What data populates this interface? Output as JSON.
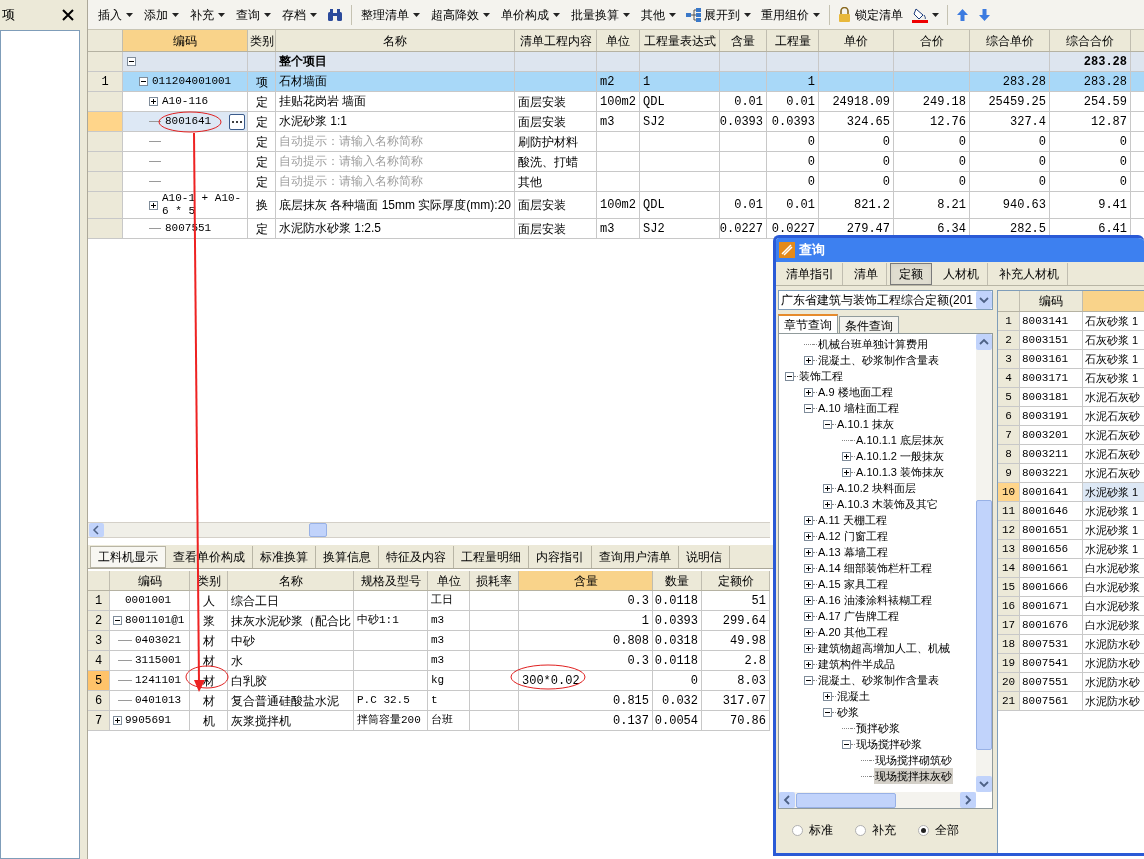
{
  "side_panel": {
    "title": "项"
  },
  "toolbar": [
    {
      "kind": "dropdown",
      "label": "插入"
    },
    {
      "kind": "dropdown",
      "label": "添加"
    },
    {
      "kind": "dropdown",
      "label": "补充"
    },
    {
      "kind": "dropdown",
      "label": "查询"
    },
    {
      "kind": "dropdown",
      "label": "存档"
    },
    {
      "kind": "find"
    },
    {
      "kind": "separator"
    },
    {
      "kind": "dropdown",
      "label": "整理清单"
    },
    {
      "kind": "dropdown",
      "label": "超高降效"
    },
    {
      "kind": "dropdown",
      "label": "单价构成"
    },
    {
      "kind": "dropdown",
      "label": "批量换算"
    },
    {
      "kind": "dropdown",
      "label": "其他"
    },
    {
      "kind": "expand",
      "label": "展开到"
    },
    {
      "kind": "dropdown",
      "label": "重用组价"
    },
    {
      "kind": "separator"
    },
    {
      "kind": "lock",
      "label": "锁定清单"
    },
    {
      "kind": "fill"
    },
    {
      "kind": "separator"
    },
    {
      "kind": "up"
    },
    {
      "kind": "down"
    }
  ],
  "bill_table": {
    "columns": [
      {
        "label": "编码",
        "selected": true
      },
      {
        "label": "类别",
        "selected": false
      },
      {
        "label": "名称",
        "selected": false
      },
      {
        "label": "清单工程内容",
        "selected": false
      },
      {
        "label": "单位",
        "selected": false
      },
      {
        "label": "工程量表达式",
        "selected": false
      },
      {
        "label": "含量",
        "selected": false
      },
      {
        "label": "工程量",
        "selected": false
      },
      {
        "label": "单价",
        "selected": false
      },
      {
        "label": "合价",
        "selected": false
      },
      {
        "label": "综合单价",
        "selected": false
      },
      {
        "label": "综合合价",
        "selected": false
      }
    ],
    "rows": [
      {
        "kind": "summary",
        "name": "整个项目",
        "comp_total": "283.28",
        "selected": false,
        "current": false,
        "expanded": true,
        "children": [
          {
            "number": "1",
            "code": "011204001001",
            "type": "项",
            "name": "石材墙面",
            "unit": "m2",
            "expr": "1",
            "quantity": "1",
            "comp_price": "283.28",
            "comp_total": "283.28",
            "selected": true,
            "current": false,
            "expanded": true,
            "children": [
              {
                "code": "A10-116",
                "type": "定",
                "name": "挂贴花岗岩 墙面",
                "content": "面层安装",
                "unit": "100m2",
                "expr": "QDL",
                "rate": "0.01",
                "quantity": "0.01",
                "price": "24918.09",
                "total": "249.18",
                "comp_price": "25459.25",
                "comp_total": "254.59",
                "selected": false,
                "current": false,
                "expanded": false
              },
              {
                "code": "8001641",
                "type": "定",
                "name": "水泥砂浆 1:1",
                "content": "面层安装",
                "unit": "m3",
                "expr": "SJ2",
                "rate": "0.0393",
                "quantity": "0.0393",
                "price": "324.65",
                "total": "12.76",
                "comp_price": "327.4",
                "comp_total": "12.87",
                "selected": false,
                "current": true
              },
              {
                "type": "定",
                "placeholder": "自动提示：请输入名称简称",
                "content": "刷防护材料",
                "quantity": "0",
                "price": "0",
                "total": "0",
                "comp_price": "0",
                "comp_total": "0",
                "selected": false,
                "current": false
              },
              {
                "type": "定",
                "placeholder": "自动提示：请输入名称简称",
                "content": "酸洗、打蜡",
                "quantity": "0",
                "price": "0",
                "total": "0",
                "comp_price": "0",
                "comp_total": "0",
                "selected": false,
                "current": false
              },
              {
                "type": "定",
                "placeholder": "自动提示：请输入名称简称",
                "content": "其他",
                "quantity": "0",
                "price": "0",
                "total": "0",
                "comp_price": "0",
                "comp_total": "0",
                "selected": false,
                "current": false
              },
              {
                "code": "A10-1 + A10-6 * 5",
                "type": "换",
                "name": "底层抹灰 各种墙面 15mm 实际厚度(mm):20",
                "content": "面层安装",
                "unit": "100m2",
                "expr": "QDL",
                "rate": "0.01",
                "quantity": "0.01",
                "price": "821.2",
                "total": "8.21",
                "comp_price": "940.63",
                "comp_total": "9.41",
                "selected": false,
                "current": false,
                "expanded": false
              },
              {
                "code": "8007551",
                "type": "定",
                "name": "水泥防水砂浆 1:2.5",
                "content": "面层安装",
                "unit": "m3",
                "expr": "SJ2",
                "rate": "0.0227",
                "quantity": "0.0227",
                "price": "279.47",
                "total": "6.34",
                "comp_price": "282.5",
                "comp_total": "6.41",
                "selected": false,
                "current": false
              }
            ]
          }
        ]
      }
    ]
  },
  "detail_tabs": [
    {
      "label": "工料机显示",
      "selected": true
    },
    {
      "label": "查看单价构成",
      "selected": false
    },
    {
      "label": "标准换算",
      "selected": false
    },
    {
      "label": "换算信息",
      "selected": false
    },
    {
      "label": "特征及内容",
      "selected": false
    },
    {
      "label": "工程量明细",
      "selected": false
    },
    {
      "label": "内容指引",
      "selected": false
    },
    {
      "label": "查询用户清单",
      "selected": false
    },
    {
      "label": "说明信",
      "selected": false
    }
  ],
  "resource_table": {
    "columns": [
      {
        "label": "编码",
        "selected": false
      },
      {
        "label": "类别",
        "selected": false
      },
      {
        "label": "名称",
        "selected": false
      },
      {
        "label": "规格及型号",
        "selected": false
      },
      {
        "label": "单位",
        "selected": false
      },
      {
        "label": "损耗率",
        "selected": false
      },
      {
        "label": "含量",
        "selected": true
      },
      {
        "label": "数量",
        "selected": false
      },
      {
        "label": "定额价",
        "selected": false
      }
    ],
    "rows": [
      {
        "number": "1",
        "code": "0001001",
        "type": "人",
        "name": "综合工日",
        "unit": "工日",
        "rate": "0.3",
        "amount": "0.0118",
        "price": "51",
        "current": false
      },
      {
        "number": "2",
        "code": "8001101@1",
        "type": "浆",
        "name": "抹灰水泥砂浆（配合比",
        "spec": "中砂1:1",
        "unit": "m3",
        "rate": "1",
        "amount": "0.0393",
        "price": "299.64",
        "current": false,
        "expanded": true,
        "children": [
          {
            "number": "3",
            "code": "0403021",
            "type": "材",
            "name": "中砂",
            "unit": "m3",
            "rate": "0.808",
            "amount": "0.0318",
            "price": "49.98",
            "current": false
          },
          {
            "number": "4",
            "code": "3115001",
            "type": "材",
            "name": "水",
            "unit": "m3",
            "rate": "0.3",
            "amount": "0.0118",
            "price": "2.8",
            "current": false
          },
          {
            "number": "5",
            "code": "1241101",
            "type": "材",
            "name": "白乳胶",
            "unit": "kg",
            "rate": "300*0.02",
            "amount": "0",
            "price": "8.03",
            "current": true,
            "editing": true
          },
          {
            "number": "6",
            "code": "0401013",
            "type": "材",
            "name": "复合普通硅酸盐水泥",
            "spec": "P.C 32.5",
            "unit": "t",
            "rate": "0.815",
            "amount": "0.032",
            "price": "317.07",
            "current": false
          }
        ]
      },
      {
        "number": "7",
        "code": "9905691",
        "type": "机",
        "name": "灰浆搅拌机",
        "spec": "拌筒容量200",
        "unit": "台班",
        "rate": "0.137",
        "amount": "0.0054",
        "price": "70.86",
        "current": false,
        "expanded": false
      }
    ]
  },
  "query_window": {
    "title": "查询",
    "tabs": [
      {
        "label": "清单指引",
        "selected": false
      },
      {
        "label": "清单",
        "selected": false
      },
      {
        "label": "定额",
        "selected": true
      },
      {
        "label": "人材机",
        "selected": false
      },
      {
        "label": "补充人材机",
        "selected": false
      }
    ],
    "library": "广东省建筑与装饰工程综合定额(201",
    "section_tabs": [
      {
        "label": "章节查询",
        "selected": true
      },
      {
        "label": "条件查询",
        "selected": false
      }
    ],
    "tree": [
      {
        "children": [
          {
            "label": "机械台班单独计算费用",
            "selected": false
          },
          {
            "label": "混凝土、砂浆制作含量表",
            "selected": false,
            "expanded": false
          }
        ]
      },
      {
        "label": "装饰工程",
        "selected": false,
        "expanded": true,
        "children": [
          {
            "label": "A.9 楼地面工程",
            "selected": false,
            "expanded": false
          },
          {
            "label": "A.10 墙柱面工程",
            "selected": false,
            "expanded": true,
            "children": [
              {
                "label": "A.10.1 抹灰",
                "selected": false,
                "expanded": true,
                "children": [
                  {
                    "label": "A.10.1.1 底层抹灰",
                    "selected": false
                  },
                  {
                    "label": "A.10.1.2 一般抹灰",
                    "selected": false,
                    "expanded": false
                  },
                  {
                    "label": "A.10.1.3 装饰抹灰",
                    "selected": false,
                    "expanded": false
                  }
                ]
              },
              {
                "label": "A.10.2 块料面层",
                "selected": false,
                "expanded": false
              },
              {
                "label": "A.10.3 木装饰及其它",
                "selected": false,
                "expanded": false
              }
            ]
          },
          {
            "label": "A.11 天棚工程",
            "selected": false,
            "expanded": false
          },
          {
            "label": "A.12 门窗工程",
            "selected": false,
            "expanded": false
          },
          {
            "label": "A.13 幕墙工程",
            "selected": false,
            "expanded": false
          },
          {
            "label": "A.14 细部装饰栏杆工程",
            "selected": false,
            "expanded": false
          },
          {
            "label": "A.15 家具工程",
            "selected": false,
            "expanded": false
          },
          {
            "label": "A.16 油漆涂料裱糊工程",
            "selected": false,
            "expanded": false
          },
          {
            "label": "A.17 广告牌工程",
            "selected": false,
            "expanded": false
          },
          {
            "label": "A.20 其他工程",
            "selected": false,
            "expanded": false
          },
          {
            "label": "建筑物超高增加人工、机械",
            "selected": false,
            "expanded": false
          },
          {
            "label": "建筑构件半成品",
            "selected": false,
            "expanded": false
          },
          {
            "label": "混凝土、砂浆制作含量表",
            "selected": false,
            "expanded": true,
            "children": [
              {
                "label": "混凝土",
                "selected": false,
                "expanded": false
              },
              {
                "label": "砂浆",
                "selected": false,
                "expanded": true,
                "children": [
                  {
                    "label": "预拌砂浆",
                    "selected": false
                  },
                  {
                    "label": "现场搅拌砂浆",
                    "selected": false,
                    "expanded": true,
                    "children": [
                      {
                        "label": "现场搅拌砌筑砂",
                        "selected": false
                      },
                      {
                        "label": "现场搅拌抹灰砂",
                        "selected": true
                      }
                    ]
                  }
                ]
              }
            ]
          }
        ]
      }
    ],
    "filters": [
      {
        "label": "标准",
        "selected": false
      },
      {
        "label": "补充",
        "selected": false
      },
      {
        "label": "全部",
        "selected": true
      }
    ],
    "results": {
      "columns": [
        {
          "label": "编码",
          "selected": false
        },
        {
          "selected": true
        }
      ],
      "rows": [
        {
          "number": "1",
          "code": "8003141",
          "name": "石灰砂浆 1",
          "selected": false
        },
        {
          "number": "2",
          "code": "8003151",
          "name": "石灰砂浆 1",
          "selected": false
        },
        {
          "number": "3",
          "code": "8003161",
          "name": "石灰砂浆 1",
          "selected": false
        },
        {
          "number": "4",
          "code": "8003171",
          "name": "石灰砂浆 1",
          "selected": false
        },
        {
          "number": "5",
          "code": "8003181",
          "name": "水泥石灰砂",
          "selected": false
        },
        {
          "number": "6",
          "code": "8003191",
          "name": "水泥石灰砂",
          "selected": false
        },
        {
          "number": "7",
          "code": "8003201",
          "name": "水泥石灰砂",
          "selected": false
        },
        {
          "number": "8",
          "code": "8003211",
          "name": "水泥石灰砂",
          "selected": false
        },
        {
          "number": "9",
          "code": "8003221",
          "name": "水泥石灰砂",
          "selected": false
        },
        {
          "number": "10",
          "code": "8001641",
          "name": "水泥砂浆 1",
          "selected": true
        },
        {
          "number": "11",
          "code": "8001646",
          "name": "水泥砂浆 1",
          "selected": false
        },
        {
          "number": "12",
          "code": "8001651",
          "name": "水泥砂浆 1",
          "selected": false
        },
        {
          "number": "13",
          "code": "8001656",
          "name": "水泥砂浆 1",
          "selected": false
        },
        {
          "number": "14",
          "code": "8001661",
          "name": "白水泥砂浆",
          "selected": false
        },
        {
          "number": "15",
          "code": "8001666",
          "name": "白水泥砂浆",
          "selected": false
        },
        {
          "number": "16",
          "code": "8001671",
          "name": "白水泥砂浆",
          "selected": false
        },
        {
          "number": "17",
          "code": "8001676",
          "name": "白水泥砂浆",
          "selected": false
        },
        {
          "number": "18",
          "code": "8007531",
          "name": "水泥防水砂",
          "selected": false
        },
        {
          "number": "19",
          "code": "8007541",
          "name": "水泥防水砂",
          "selected": false
        },
        {
          "number": "20",
          "code": "8007551",
          "name": "水泥防水砂",
          "selected": false
        },
        {
          "number": "21",
          "code": "8007561",
          "name": "水泥防水砂",
          "selected": false
        }
      ]
    }
  }
}
